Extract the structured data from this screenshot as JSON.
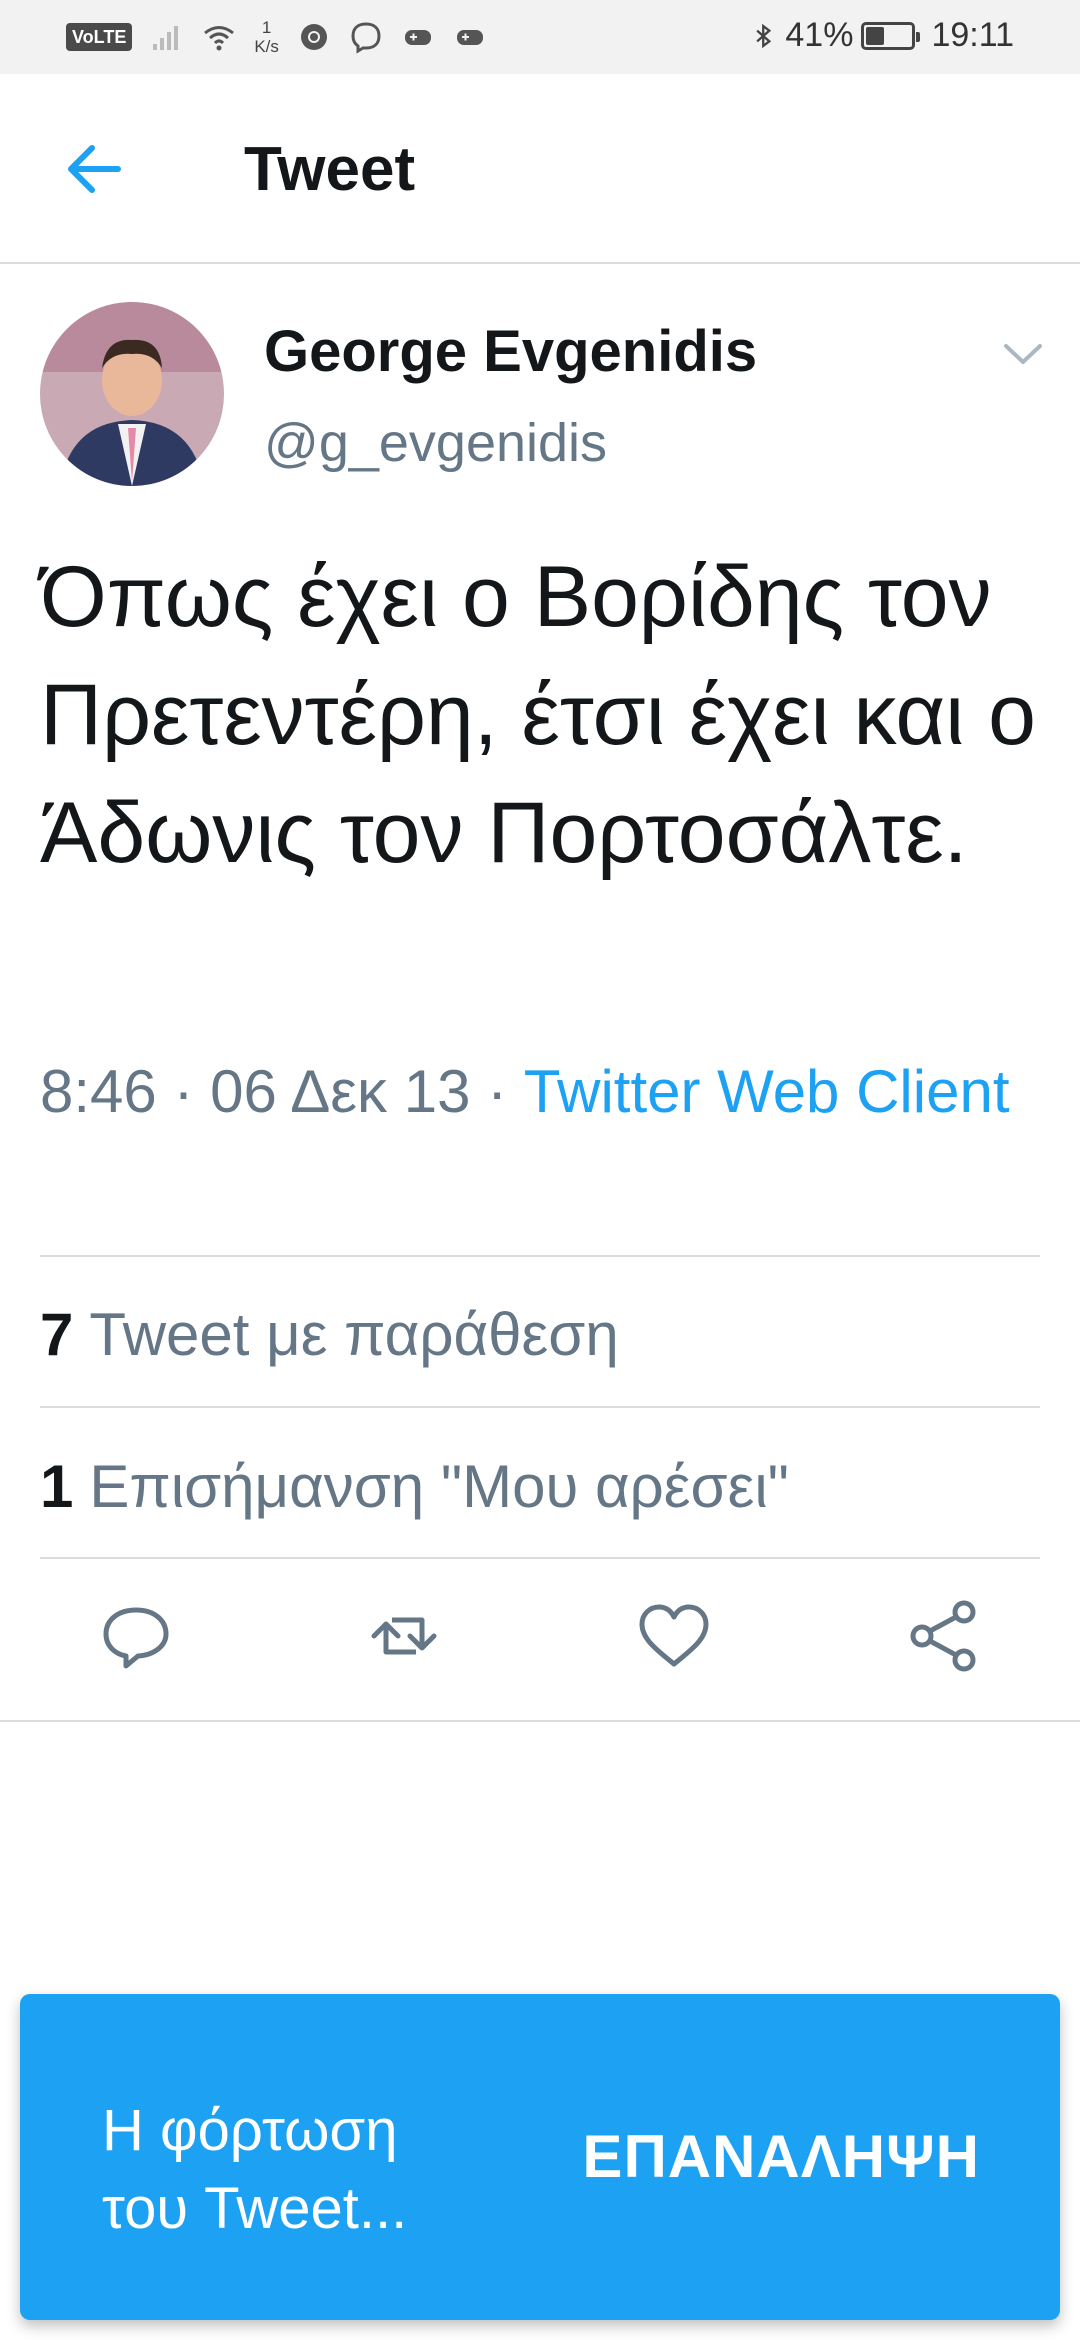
{
  "status_bar": {
    "volte": "VoLTE",
    "speed_value": "1",
    "speed_unit": "K/s",
    "battery_percent": "41%",
    "battery_level": 0.41,
    "time": "19:11"
  },
  "header": {
    "title": "Tweet"
  },
  "tweet": {
    "author_name": "George Evgenidis",
    "author_handle": "@g_evgenidis",
    "text": "Όπως έχει ο Βορίδης τον Πρετεντέρη, έτσι έχει και ο Άδωνις τον Πορτοσάλτε.",
    "time": "8:46",
    "separator": "·",
    "date": "06 Δεκ 13",
    "source": "Twitter Web Client"
  },
  "stats": {
    "quote_count": "7",
    "quote_label": "Tweet με παράθεση",
    "like_count": "1",
    "like_label": "Επισήμανση \"Μου αρέσει\""
  },
  "actions": {
    "reply_icon": "reply-icon",
    "retweet_icon": "retweet-icon",
    "like_icon": "heart-icon",
    "share_icon": "share-icon"
  },
  "snackbar": {
    "message": "Η φόρτωση\nτου Tweet...",
    "action_label": "ΕΠΑΝΑΛΗΨΗ"
  },
  "colors": {
    "accent": "#1da1f2",
    "text": "#14171a",
    "secondary_text": "#657786",
    "divider": "#d9dde0"
  }
}
